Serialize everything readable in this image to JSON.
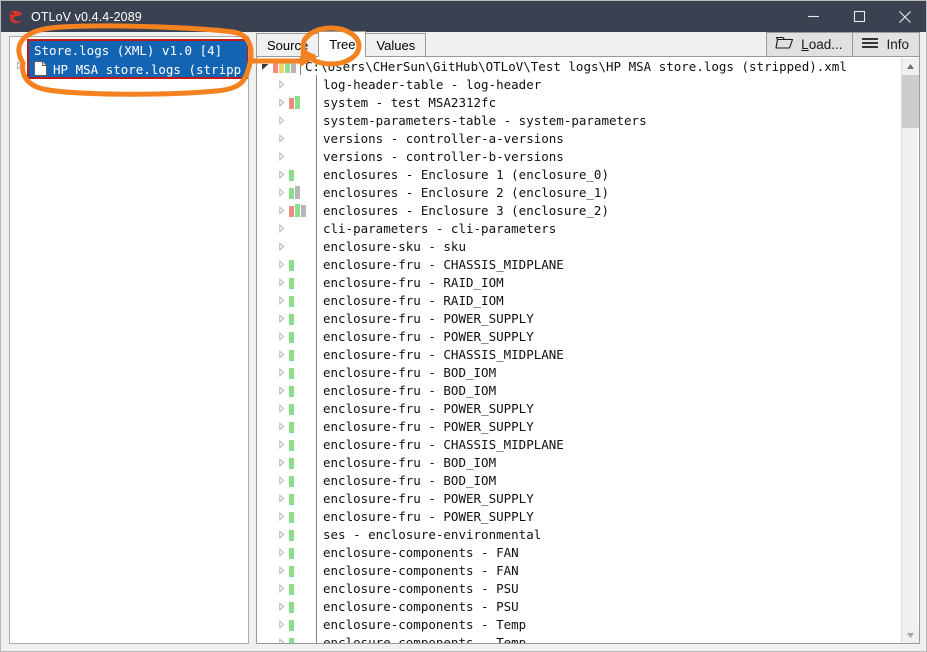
{
  "window": {
    "title": "OTLoV v0.4.4-2089",
    "app_icon": "otlov-logo-icon",
    "minimize_label": "Minimize",
    "maximize_label": "Maximize",
    "close_label": "Close"
  },
  "left_panel": {
    "expander_icon": "chevron-right-icon",
    "selected_group": {
      "title": "Store.logs (XML) v1.0 [4]",
      "child_icon": "document-icon",
      "child_label": "HP MSA store.logs (stripp"
    }
  },
  "tabs": [
    {
      "label": "Source",
      "active": false
    },
    {
      "label": "Tree",
      "active": true
    },
    {
      "label": "Values",
      "active": false
    }
  ],
  "toolbar": {
    "load": {
      "label_prefix": "L",
      "label_rest": "oad...",
      "icon": "open-folder-icon"
    },
    "info": {
      "label": "Info",
      "icon": "hamburger-menu-icon"
    }
  },
  "scrollbar": {
    "up_icon": "scroll-up-arrow-icon",
    "down_icon": "scroll-down-arrow-icon"
  },
  "colors": {
    "titlebar": "#3a4150",
    "selection": "#1464b4",
    "annotation": "#f58220",
    "highlight_border": "#c01818",
    "bar_red": "#ef8a80",
    "bar_yellow": "#f2d06b",
    "bar_green": "#8ddd8a",
    "bar_gray": "#b6b6b6"
  },
  "tree": {
    "root": {
      "expander": "expanded",
      "label": "C:\\Users\\CHerSun\\GitHub\\OTLoV\\Test logs\\HP MSA store.logs (stripped).xml",
      "bars": [
        "#ef8a80",
        "#f2d06b",
        "#8ddd8a",
        "#b6b6b6"
      ]
    },
    "nodes": [
      {
        "label": "log-header-table - log-header",
        "bars": []
      },
      {
        "label": "system - test MSA2312fc",
        "bars": [
          "#ef8a80",
          "#8ddd8a"
        ]
      },
      {
        "label": "system-parameters-table - system-parameters",
        "bars": []
      },
      {
        "label": "versions - controller-a-versions",
        "bars": []
      },
      {
        "label": "versions - controller-b-versions",
        "bars": []
      },
      {
        "label": "enclosures - Enclosure 1 (enclosure_0)",
        "bars": [
          "#8ddd8a"
        ]
      },
      {
        "label": "enclosures - Enclosure 2 (enclosure_1)",
        "bars": [
          "#8ddd8a",
          "#b6b6b6"
        ]
      },
      {
        "label": "enclosures - Enclosure 3 (enclosure_2)",
        "bars": [
          "#ef8a80",
          "#8ddd8a",
          "#b6b6b6"
        ]
      },
      {
        "label": "cli-parameters - cli-parameters",
        "bars": []
      },
      {
        "label": "enclosure-sku - sku",
        "bars": []
      },
      {
        "label": "enclosure-fru - CHASSIS_MIDPLANE",
        "bars": [
          "#8ddd8a"
        ]
      },
      {
        "label": "enclosure-fru - RAID_IOM",
        "bars": [
          "#8ddd8a"
        ]
      },
      {
        "label": "enclosure-fru - RAID_IOM",
        "bars": [
          "#8ddd8a"
        ]
      },
      {
        "label": "enclosure-fru - POWER_SUPPLY",
        "bars": [
          "#8ddd8a"
        ]
      },
      {
        "label": "enclosure-fru - POWER_SUPPLY",
        "bars": [
          "#8ddd8a"
        ]
      },
      {
        "label": "enclosure-fru - CHASSIS_MIDPLANE",
        "bars": [
          "#8ddd8a"
        ]
      },
      {
        "label": "enclosure-fru - BOD_IOM",
        "bars": [
          "#8ddd8a"
        ]
      },
      {
        "label": "enclosure-fru - BOD_IOM",
        "bars": [
          "#8ddd8a"
        ]
      },
      {
        "label": "enclosure-fru - POWER_SUPPLY",
        "bars": [
          "#8ddd8a"
        ]
      },
      {
        "label": "enclosure-fru - POWER_SUPPLY",
        "bars": [
          "#8ddd8a"
        ]
      },
      {
        "label": "enclosure-fru - CHASSIS_MIDPLANE",
        "bars": [
          "#8ddd8a"
        ]
      },
      {
        "label": "enclosure-fru - BOD_IOM",
        "bars": [
          "#8ddd8a"
        ]
      },
      {
        "label": "enclosure-fru - BOD_IOM",
        "bars": [
          "#8ddd8a"
        ]
      },
      {
        "label": "enclosure-fru - POWER_SUPPLY",
        "bars": [
          "#8ddd8a"
        ]
      },
      {
        "label": "enclosure-fru - POWER_SUPPLY",
        "bars": [
          "#8ddd8a"
        ]
      },
      {
        "label": "ses - enclosure-environmental",
        "bars": [
          "#8ddd8a"
        ]
      },
      {
        "label": "enclosure-components - FAN",
        "bars": [
          "#8ddd8a"
        ]
      },
      {
        "label": "enclosure-components - FAN",
        "bars": [
          "#8ddd8a"
        ]
      },
      {
        "label": "enclosure-components - PSU",
        "bars": [
          "#8ddd8a"
        ]
      },
      {
        "label": "enclosure-components - PSU",
        "bars": [
          "#8ddd8a"
        ]
      },
      {
        "label": "enclosure-components - Temp",
        "bars": [
          "#8ddd8a"
        ]
      },
      {
        "label": "enclosure-components - Temp",
        "bars": [
          "#8ddd8a"
        ]
      }
    ]
  }
}
